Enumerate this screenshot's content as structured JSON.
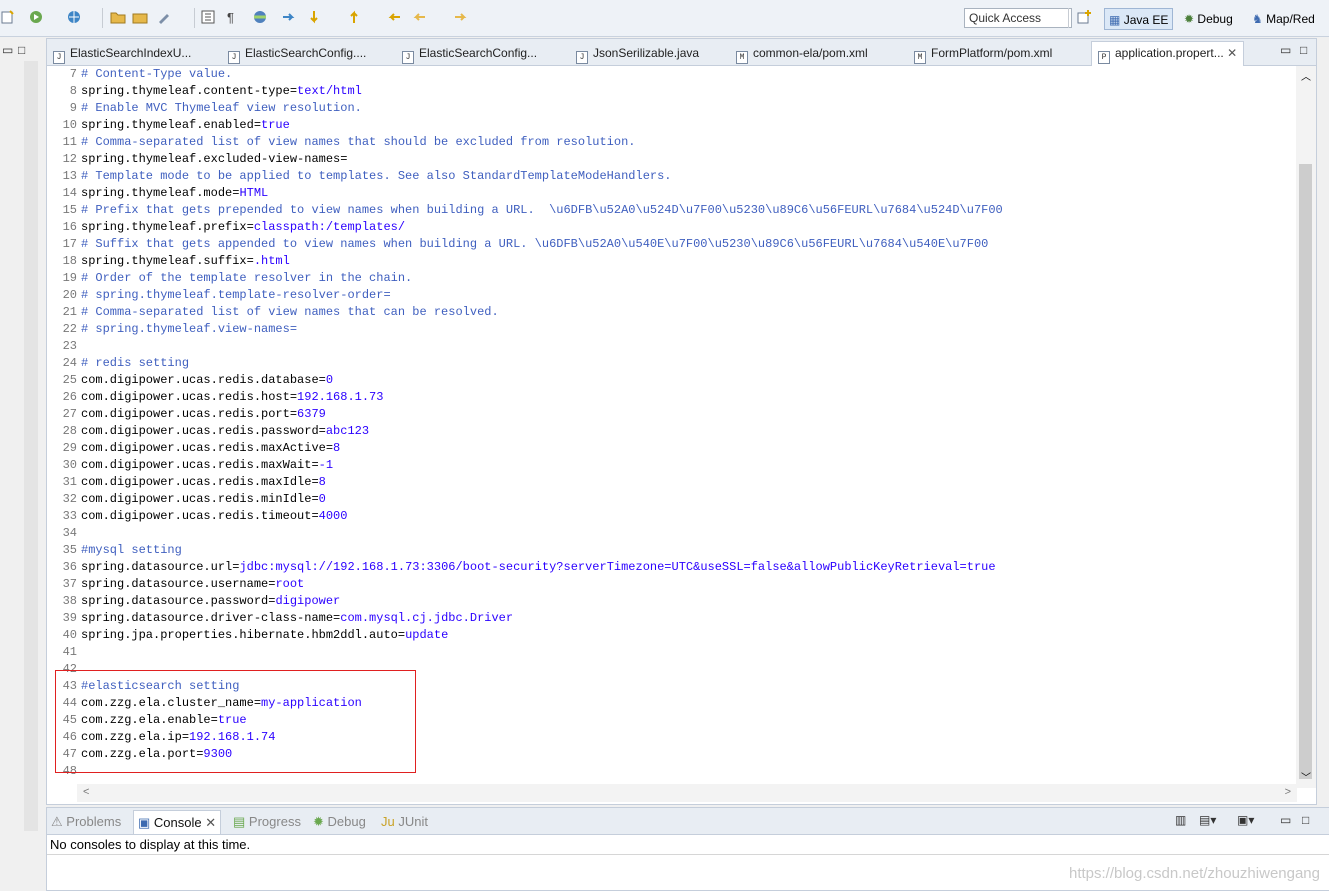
{
  "toolbar": {
    "quick_access": "Quick Access",
    "perspectives": [
      "Java EE",
      "Debug",
      "Map/Red"
    ]
  },
  "editor": {
    "tabs": [
      {
        "label": "ElasticSearchIndexU...",
        "icon": "J"
      },
      {
        "label": "ElasticSearchConfig....",
        "icon": "J"
      },
      {
        "label": "ElasticSearchConfig...",
        "icon": "J"
      },
      {
        "label": "JsonSerilizable.java",
        "icon": "J"
      },
      {
        "label": "common-ela/pom.xml",
        "icon": "M"
      },
      {
        "label": "FormPlatform/pom.xml",
        "icon": "M"
      },
      {
        "label": "application.propert...",
        "icon": "P"
      }
    ],
    "lines": [
      {
        "n": "7",
        "k": "# Content-Type value.",
        "v": ""
      },
      {
        "n": "8",
        "k": "spring.thymeleaf.content-type=",
        "v": "text/html"
      },
      {
        "n": "9",
        "k": "# Enable MVC Thymeleaf view resolution.",
        "v": ""
      },
      {
        "n": "10",
        "k": "spring.thymeleaf.enabled=",
        "v": "true"
      },
      {
        "n": "11",
        "k": "# Comma-separated list of view names that should be excluded from resolution.",
        "v": ""
      },
      {
        "n": "12",
        "k": "spring.thymeleaf.excluded-view-names=",
        "v": ""
      },
      {
        "n": "13",
        "k": "# Template mode to be applied to templates. See also StandardTemplateModeHandlers.",
        "v": ""
      },
      {
        "n": "14",
        "k": "spring.thymeleaf.mode=",
        "v": "HTML"
      },
      {
        "n": "15",
        "k": "# Prefix that gets prepended to view names when building a URL.  \\u6DFB\\u52A0\\u524D\\u7F00\\u5230\\u89C6\\u56FEURL\\u7684\\u524D\\u7F00",
        "v": ""
      },
      {
        "n": "16",
        "k": "spring.thymeleaf.prefix=",
        "v": "classpath:/templates/"
      },
      {
        "n": "17",
        "k": "# Suffix that gets appended to view names when building a URL. \\u6DFB\\u52A0\\u540E\\u7F00\\u5230\\u89C6\\u56FEURL\\u7684\\u540E\\u7F00",
        "v": ""
      },
      {
        "n": "18",
        "k": "spring.thymeleaf.suffix=",
        "v": ".html"
      },
      {
        "n": "19",
        "k": "# Order of the template resolver in the chain.",
        "v": ""
      },
      {
        "n": "20",
        "k": "# spring.thymeleaf.template-resolver-order=",
        "v": ""
      },
      {
        "n": "21",
        "k": "# Comma-separated list of view names that can be resolved.",
        "v": ""
      },
      {
        "n": "22",
        "k": "# spring.thymeleaf.view-names=",
        "v": ""
      },
      {
        "n": "23",
        "k": "",
        "v": ""
      },
      {
        "n": "24",
        "k": "# redis setting",
        "v": ""
      },
      {
        "n": "25",
        "k": "com.digipower.ucas.redis.database=",
        "v": "0"
      },
      {
        "n": "26",
        "k": "com.digipower.ucas.redis.host=",
        "v": "192.168.1.73"
      },
      {
        "n": "27",
        "k": "com.digipower.ucas.redis.port=",
        "v": "6379"
      },
      {
        "n": "28",
        "k": "com.digipower.ucas.redis.password=",
        "v": "abc123"
      },
      {
        "n": "29",
        "k": "com.digipower.ucas.redis.maxActive=",
        "v": "8"
      },
      {
        "n": "30",
        "k": "com.digipower.ucas.redis.maxWait=",
        "v": "-1"
      },
      {
        "n": "31",
        "k": "com.digipower.ucas.redis.maxIdle=",
        "v": "8"
      },
      {
        "n": "32",
        "k": "com.digipower.ucas.redis.minIdle=",
        "v": "0"
      },
      {
        "n": "33",
        "k": "com.digipower.ucas.redis.timeout=",
        "v": "4000"
      },
      {
        "n": "34",
        "k": "",
        "v": ""
      },
      {
        "n": "35",
        "k": "#mysql setting",
        "v": ""
      },
      {
        "n": "36",
        "k": "spring.datasource.url=",
        "v": "jdbc:mysql://192.168.1.73:3306/boot-security?serverTimezone=UTC&useSSL=false&allowPublicKeyRetrieval=true"
      },
      {
        "n": "37",
        "k": "spring.datasource.username=",
        "v": "root"
      },
      {
        "n": "38",
        "k": "spring.datasource.password=",
        "v": "digipower"
      },
      {
        "n": "39",
        "k": "spring.datasource.driver-class-name=",
        "v": "com.mysql.cj.jdbc.Driver"
      },
      {
        "n": "40",
        "k": "spring.jpa.properties.hibernate.hbm2ddl.auto=",
        "v": "update"
      },
      {
        "n": "41",
        "k": "",
        "v": ""
      },
      {
        "n": "42",
        "k": "",
        "v": ""
      },
      {
        "n": "43",
        "k": "#elasticsearch setting",
        "v": ""
      },
      {
        "n": "44",
        "k": "com.zzg.ela.cluster_name=",
        "v": "my-application"
      },
      {
        "n": "45",
        "k": "com.zzg.ela.enable=",
        "v": "true"
      },
      {
        "n": "46",
        "k": "com.zzg.ela.ip=",
        "v": "192.168.1.74"
      },
      {
        "n": "47",
        "k": "com.zzg.ela.port=",
        "v": "9300"
      },
      {
        "n": "48",
        "k": "",
        "v": ""
      }
    ]
  },
  "bottom": {
    "tabs": [
      "Problems",
      "Console",
      "Progress",
      "Debug",
      "JUnit"
    ],
    "message": "No consoles to display at this time.",
    "watermark": "https://blog.csdn.net/zhouzhiwengang"
  },
  "colors": {
    "comment": "#3f5fbf",
    "value": "#2a00ff",
    "linenumber": "#787878",
    "highlight_box": "#e02020"
  }
}
